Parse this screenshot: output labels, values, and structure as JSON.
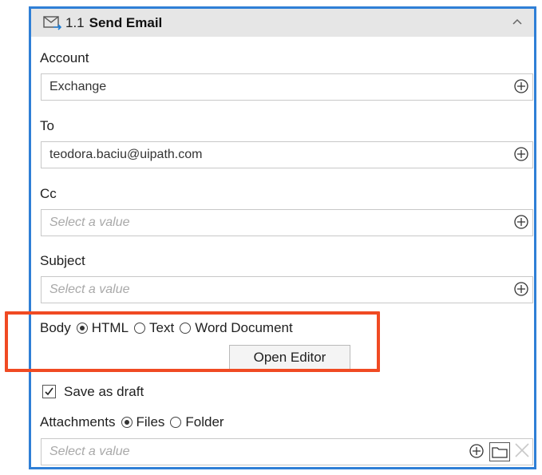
{
  "header": {
    "step": "1.1",
    "title": "Send Email"
  },
  "account": {
    "label": "Account",
    "value": "Exchange"
  },
  "to": {
    "label": "To",
    "value": "teodora.baciu@uipath.com"
  },
  "cc": {
    "label": "Cc",
    "placeholder": "Select a value"
  },
  "subject": {
    "label": "Subject",
    "placeholder": "Select a value"
  },
  "body": {
    "label": "Body",
    "options": [
      "HTML",
      "Text",
      "Word Document"
    ],
    "selected": "HTML",
    "open_editor": "Open Editor"
  },
  "save_as_draft": {
    "label": "Save as draft",
    "checked": true
  },
  "attachments": {
    "label": "Attachments",
    "options": [
      "Files",
      "Folder"
    ],
    "selected": "Files",
    "placeholder": "Select a value"
  },
  "icons": {
    "header": "mail-send-icon",
    "collapse": "chevron-up-icon",
    "add": "plus-circle-icon",
    "folder": "folder-icon",
    "clear": "close-icon"
  },
  "colors": {
    "panel_border": "#2f7fd6",
    "highlight": "#f04a23",
    "header_bg": "#e6e6e6"
  }
}
